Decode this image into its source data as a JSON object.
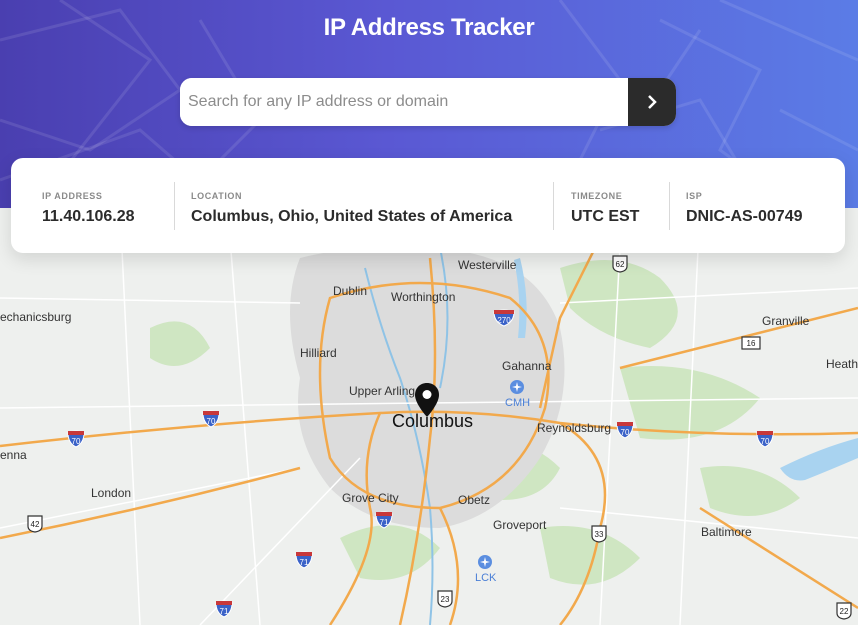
{
  "header": {
    "title": "IP Address Tracker"
  },
  "search": {
    "placeholder": "Search for any IP address or domain",
    "value": "",
    "button_icon": "chevron-right-icon"
  },
  "info": {
    "ip": {
      "label": "IP ADDRESS",
      "value": "11.40.106.28"
    },
    "location": {
      "label": "LOCATION",
      "value": "Columbus, Ohio, United States of America"
    },
    "timezone": {
      "label": "TIMEZONE",
      "value": "UTC EST"
    },
    "isp": {
      "label": "ISP",
      "value": "DNIC-AS-00749"
    }
  },
  "map": {
    "marker_icon": "map-pin-icon",
    "places": {
      "westerville": "Westerville",
      "dublin": "Dublin",
      "worthington": "Worthington",
      "mechanicsburg": "echanicsburg",
      "hilliard": "Hilliard",
      "gahanna": "Gahanna",
      "upper_arlington": "Upper Arling",
      "columbus": "Columbus",
      "reynoldsburg": "Reynoldsburg",
      "granville": "Granville",
      "heath": "Heath",
      "london": "London",
      "grove_city": "Grove City",
      "obetz": "Obetz",
      "groveport": "Groveport",
      "baltimore": "Baltimore",
      "enna": "enna"
    },
    "airports": {
      "cmh": "CMH",
      "lck": "LCK"
    },
    "highways": {
      "i270": "270",
      "i70a": "70",
      "i70b": "70",
      "i70c": "70",
      "i70d": "70",
      "i71a": "71",
      "i71b": "71",
      "i71c": "71",
      "us62": "62",
      "us16": "16",
      "us42": "42",
      "us33": "33",
      "us23": "23",
      "us22": "22"
    },
    "colors": {
      "land": "#eef0ee",
      "urban": "#dcdcdc",
      "green": "#cfe6c2",
      "water": "#a9d3f0",
      "highway": "#f2a94c",
      "interstate_shield": "#3a62c8"
    }
  }
}
